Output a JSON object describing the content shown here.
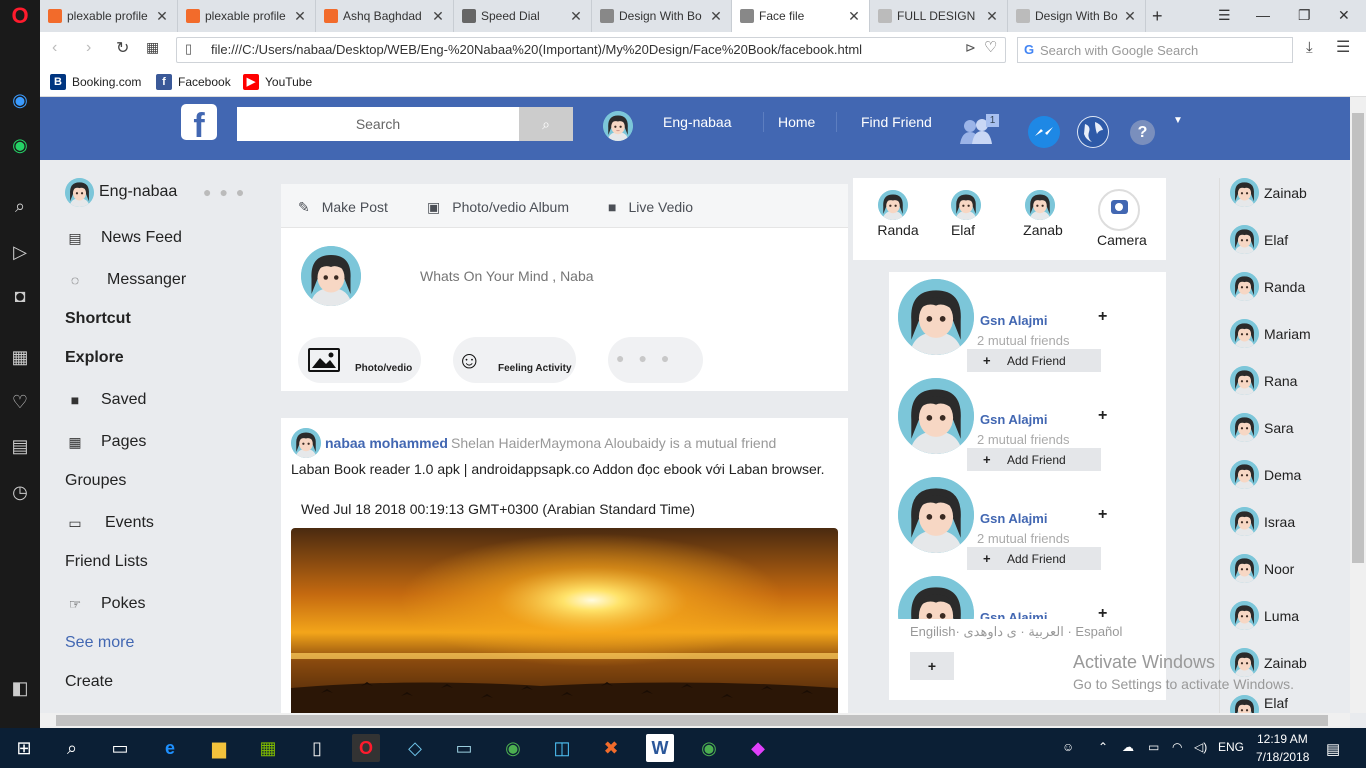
{
  "browser": {
    "tabs": [
      {
        "label": "plexable profile",
        "favicon_color": "#f26b2b"
      },
      {
        "label": "plexable profile",
        "favicon_color": "#f26b2b"
      },
      {
        "label": "Ashq Baghdad",
        "favicon_color": "#f26b2b"
      },
      {
        "label": "Speed Dial",
        "favicon_color": "#666666"
      },
      {
        "label": "Design With Bo",
        "favicon_color": "#888888"
      },
      {
        "label": "Face file",
        "favicon_color": "#888888"
      },
      {
        "label": "FULL DESIGN",
        "favicon_color": "#bbbbbb"
      },
      {
        "label": "Design With Bo",
        "favicon_color": "#bbbbbb"
      }
    ],
    "url": "file:///C:/Users/nabaa/Desktop/WEB/Eng-%20Nabaa%20(Important)/My%20Design/Face%20Book/facebook.html",
    "search_placeholder": "Search with Google Search",
    "bookmarks": [
      {
        "label": "Booking.com",
        "icon": "B",
        "color": "#003580"
      },
      {
        "label": "Facebook",
        "icon": "f",
        "color": "#3b5998"
      },
      {
        "label": "YouTube",
        "icon": "▶",
        "color": "#ff0000"
      }
    ]
  },
  "header": {
    "search_placeholder": "Search",
    "username": "Eng-nabaa",
    "home": "Home",
    "find_friend": "Find Friend",
    "friend_badge": "1",
    "help": "?"
  },
  "left": {
    "username": "Eng-nabaa",
    "items": [
      {
        "label": "News Feed",
        "icon": "▤"
      },
      {
        "label": "Messanger",
        "icon": "◌"
      }
    ],
    "shortcut": "Shortcut",
    "explore": "Explore",
    "explore_items": [
      {
        "label": "Saved",
        "icon": "■"
      },
      {
        "label": "Pages",
        "icon": "▦"
      }
    ],
    "groupes": "Groupes",
    "events": "Events",
    "friend_lists": "Friend Lists",
    "pokes": "Pokes",
    "see_more": "See more",
    "create": "Create"
  },
  "composer": {
    "tabs": [
      "Make Post",
      "Photo/vedio Album",
      "Live Vedio"
    ],
    "placeholder": "Whats On Your Mind , Nabaa",
    "photo": "Photo/vedio",
    "feeling": "Feeling Activity"
  },
  "post": {
    "author": "nabaa mohammed",
    "mutual": "Shelan HaiderMaymona Aloubaidy is a mutual friend",
    "text": "Laban Book reader 1.0 apk | androidappsapk.co Addon đọc ebook với Laban browser.",
    "date": "Wed Jul 18 2018 00:19:13 GMT+0300 (Arabian Standard Time)"
  },
  "stories": [
    {
      "name": "Randa"
    },
    {
      "name": "Elaf"
    },
    {
      "name": "Zanab"
    }
  ],
  "camera": "Camera",
  "suggestions": [
    {
      "name": "Gsn Alajmi",
      "mutual": "2 mutual friends",
      "button": "Add Friend"
    },
    {
      "name": "Gsn Alajmi",
      "mutual": "2 mutual friends",
      "button": "Add Friend"
    },
    {
      "name": "Gsn Alajmi",
      "mutual": "2 mutual friends",
      "button": "Add Friend"
    },
    {
      "name": "Gsn Alajmi"
    }
  ],
  "languages": "Engilish· العربية · ى داوهدى · Español",
  "chat": [
    "Zainab",
    "Elaf",
    "Randa",
    "Mariam",
    "Rana",
    "Sara",
    "Dema",
    "Israa",
    "Noor",
    "Luma",
    "Zainab",
    "Elaf"
  ],
  "watermark": {
    "title": "Activate Windows",
    "sub": "Go to Settings to activate Windows."
  },
  "taskbar": {
    "lang": "ENG",
    "time": "12:19 AM",
    "date": "7/18/2018"
  }
}
